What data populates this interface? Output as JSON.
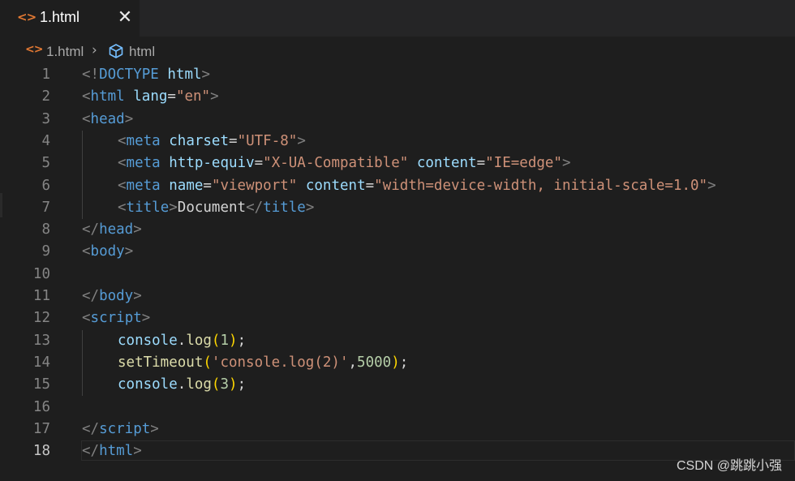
{
  "tab": {
    "label": "1.html",
    "icon": "html-file-icon",
    "close_glyph": "✕"
  },
  "breadcrumb": {
    "file": "1.html",
    "separator": "›",
    "element": "html"
  },
  "colors": {
    "background": "#1e1e1e",
    "tag": "#569cd6",
    "attribute": "#9cdcfe",
    "string": "#ce9178",
    "punctuation": "#808080",
    "function": "#dcdcaa",
    "number": "#b5cea8",
    "bracket": "#ffd700",
    "html_icon": "#e37933"
  },
  "editor": {
    "current_line": 18,
    "lines": [
      {
        "n": "1",
        "indent": 0,
        "tokens": [
          [
            "p",
            "<!"
          ],
          [
            "tag",
            "DOCTYPE"
          ],
          [
            "t",
            " "
          ],
          [
            "attr",
            "html"
          ],
          [
            "p",
            ">"
          ]
        ]
      },
      {
        "n": "2",
        "indent": 0,
        "tokens": [
          [
            "p",
            "<"
          ],
          [
            "tag",
            "html"
          ],
          [
            "t",
            " "
          ],
          [
            "attr",
            "lang"
          ],
          [
            "t",
            "="
          ],
          [
            "str",
            "\"en\""
          ],
          [
            "p",
            ">"
          ]
        ]
      },
      {
        "n": "3",
        "indent": 0,
        "tokens": [
          [
            "p",
            "<"
          ],
          [
            "tag",
            "head"
          ],
          [
            "p",
            ">"
          ]
        ]
      },
      {
        "n": "4",
        "indent": 1,
        "tokens": [
          [
            "p",
            "<"
          ],
          [
            "tag",
            "meta"
          ],
          [
            "t",
            " "
          ],
          [
            "attr",
            "charset"
          ],
          [
            "t",
            "="
          ],
          [
            "str",
            "\"UTF-8\""
          ],
          [
            "p",
            ">"
          ]
        ]
      },
      {
        "n": "5",
        "indent": 1,
        "tokens": [
          [
            "p",
            "<"
          ],
          [
            "tag",
            "meta"
          ],
          [
            "t",
            " "
          ],
          [
            "attr",
            "http-equiv"
          ],
          [
            "t",
            "="
          ],
          [
            "str",
            "\"X-UA-Compatible\""
          ],
          [
            "t",
            " "
          ],
          [
            "attr",
            "content"
          ],
          [
            "t",
            "="
          ],
          [
            "str",
            "\"IE=edge\""
          ],
          [
            "p",
            ">"
          ]
        ]
      },
      {
        "n": "6",
        "indent": 1,
        "tokens": [
          [
            "p",
            "<"
          ],
          [
            "tag",
            "meta"
          ],
          [
            "t",
            " "
          ],
          [
            "attr",
            "name"
          ],
          [
            "t",
            "="
          ],
          [
            "str",
            "\"viewport\""
          ],
          [
            "t",
            " "
          ],
          [
            "attr",
            "content"
          ],
          [
            "t",
            "="
          ],
          [
            "str",
            "\"width=device-width, initial-scale=1.0\""
          ],
          [
            "p",
            ">"
          ]
        ]
      },
      {
        "n": "7",
        "indent": 1,
        "tokens": [
          [
            "p",
            "<"
          ],
          [
            "tag",
            "title"
          ],
          [
            "p",
            ">"
          ],
          [
            "t",
            "Document"
          ],
          [
            "p",
            "</"
          ],
          [
            "tag",
            "title"
          ],
          [
            "p",
            ">"
          ]
        ]
      },
      {
        "n": "8",
        "indent": 0,
        "tokens": [
          [
            "p",
            "</"
          ],
          [
            "tag",
            "head"
          ],
          [
            "p",
            ">"
          ]
        ]
      },
      {
        "n": "9",
        "indent": 0,
        "tokens": [
          [
            "p",
            "<"
          ],
          [
            "tag",
            "body"
          ],
          [
            "p",
            ">"
          ]
        ]
      },
      {
        "n": "10",
        "indent": 0,
        "tokens": []
      },
      {
        "n": "11",
        "indent": 0,
        "tokens": [
          [
            "p",
            "</"
          ],
          [
            "tag",
            "body"
          ],
          [
            "p",
            ">"
          ]
        ]
      },
      {
        "n": "12",
        "indent": 0,
        "tokens": [
          [
            "p",
            "<"
          ],
          [
            "tag",
            "script"
          ],
          [
            "p",
            ">"
          ]
        ]
      },
      {
        "n": "13",
        "indent": 1,
        "tokens": [
          [
            "var",
            "console"
          ],
          [
            "t",
            "."
          ],
          [
            "fn",
            "log"
          ],
          [
            "br",
            "("
          ],
          [
            "num",
            "1"
          ],
          [
            "br",
            ")"
          ],
          [
            "t",
            ";"
          ]
        ]
      },
      {
        "n": "14",
        "indent": 1,
        "tokens": [
          [
            "fn",
            "setTimeout"
          ],
          [
            "br",
            "("
          ],
          [
            "str",
            "'console.log(2)'"
          ],
          [
            "t",
            ","
          ],
          [
            "num",
            "5000"
          ],
          [
            "br",
            ")"
          ],
          [
            "t",
            ";"
          ]
        ]
      },
      {
        "n": "15",
        "indent": 1,
        "tokens": [
          [
            "var",
            "console"
          ],
          [
            "t",
            "."
          ],
          [
            "fn",
            "log"
          ],
          [
            "br",
            "("
          ],
          [
            "num",
            "3"
          ],
          [
            "br",
            ")"
          ],
          [
            "t",
            ";"
          ]
        ]
      },
      {
        "n": "16",
        "indent": 0,
        "tokens": []
      },
      {
        "n": "17",
        "indent": 0,
        "tokens": [
          [
            "p",
            "</"
          ],
          [
            "tag",
            "script"
          ],
          [
            "p",
            ">"
          ]
        ]
      },
      {
        "n": "18",
        "indent": 0,
        "tokens": [
          [
            "p",
            "</"
          ],
          [
            "tag",
            "html"
          ],
          [
            "p",
            ">"
          ]
        ]
      }
    ]
  },
  "watermark": "CSDN @跳跳小强"
}
